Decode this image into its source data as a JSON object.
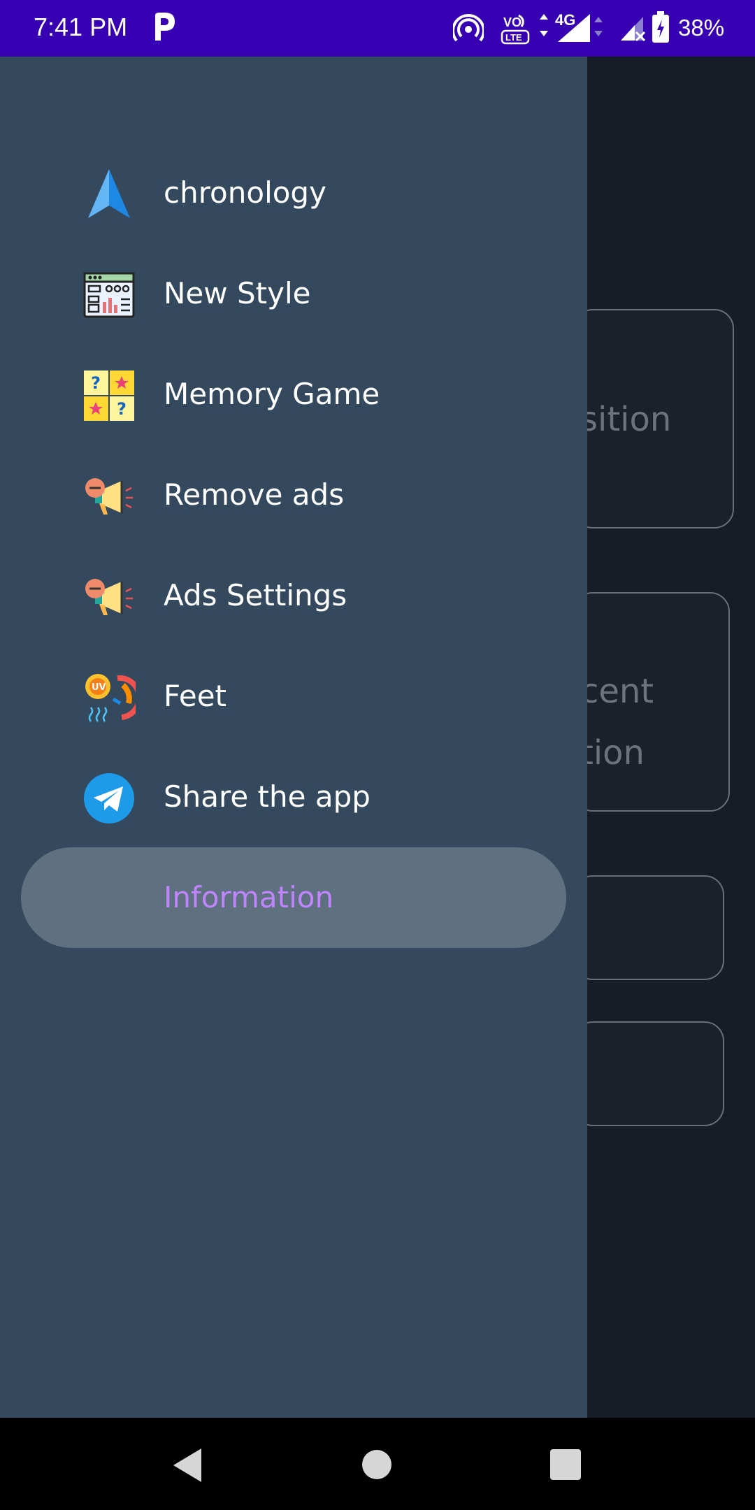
{
  "status_bar": {
    "time": "7:41 PM",
    "network": "4G",
    "volte": "Vo LTE",
    "battery": "38%",
    "icons": [
      "parking-p-icon",
      "hotspot-icon",
      "volte-icon",
      "signal-icon",
      "wifi-off-icon",
      "battery-charging-icon"
    ]
  },
  "background": {
    "card1_text": "sition",
    "card2_line1": "cent",
    "card2_line2": "tion"
  },
  "drawer": {
    "items": [
      {
        "label": "chronology",
        "icon": "navigation-arrow-icon"
      },
      {
        "label": "New Style",
        "icon": "dashboard-window-icon"
      },
      {
        "label": "Memory Game",
        "icon": "memory-cards-icon"
      },
      {
        "label": "Remove ads",
        "icon": "megaphone-icon"
      },
      {
        "label": "Ads Settings",
        "icon": "megaphone-icon"
      },
      {
        "label": "Feet",
        "icon": "uv-sun-icon"
      },
      {
        "label": "Share the app",
        "icon": "telegram-icon"
      },
      {
        "label": "Information",
        "icon": "",
        "active": true
      }
    ],
    "active_color": "#c084fc",
    "background_color": "#34495e"
  },
  "nav_bar": {
    "buttons": [
      "back-icon",
      "home-icon",
      "recents-icon"
    ]
  }
}
